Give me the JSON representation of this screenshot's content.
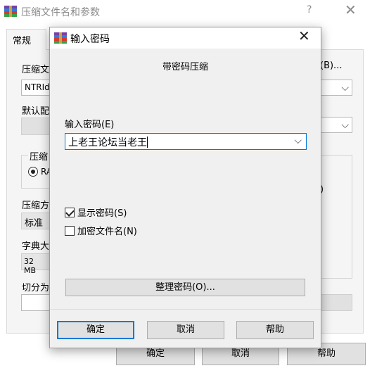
{
  "main_window": {
    "title": "压缩文件名和参数",
    "help_glyph": "?",
    "close_glyph": "✕",
    "tab_general": "常规",
    "archive_name_label": "压缩文",
    "archive_name_value": "NTRId",
    "browse_button": "(B)...",
    "default_config_label": "默认配",
    "compress_format_label": "压缩",
    "format_radio_label": "RA",
    "option_paren": ")",
    "method_label": "压缩方",
    "method_value": "标准",
    "dict_label": "字典大",
    "dict_value": "32 MB",
    "split_label": "切分为",
    "ok_button": "确定",
    "cancel_button": "取消",
    "help_button": "帮助"
  },
  "dialog": {
    "title": "输入密码",
    "close_glyph": "✕",
    "heading": "带密码压缩",
    "password_label": "输入密码(E)",
    "password_value": "上老王论坛当老王",
    "show_password_label": "显示密码(S)",
    "show_password_checked": true,
    "encrypt_names_label": "加密文件名(N)",
    "encrypt_names_checked": false,
    "organize_button": "整理密码(O)...",
    "ok_button": "确定",
    "cancel_button": "取消",
    "help_button": "帮助"
  },
  "icons": {
    "chevron": "⌵"
  },
  "colors": {
    "focus_blue": "#0078d7",
    "dialog_bg": "#f0f0f0",
    "button_bg": "#e1e1e1"
  }
}
